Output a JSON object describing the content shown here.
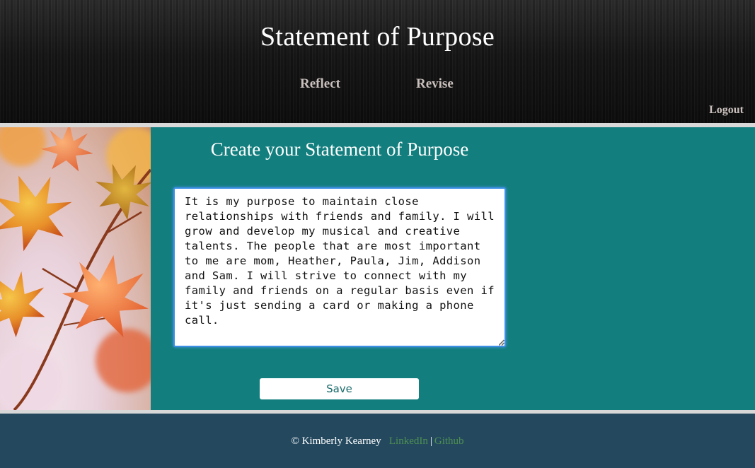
{
  "header": {
    "title": "Statement of Purpose",
    "nav": [
      {
        "label": "Reflect"
      },
      {
        "label": "Revise"
      }
    ],
    "logout_label": "Logout"
  },
  "main": {
    "heading": "Create your Statement of Purpose",
    "statement_text": "It is my purpose to maintain close relationships with friends and family. I will grow and develop my musical and creative talents. The people that are most important to me are mom, Heather, Paula, Jim, Addison and Sam. I will strive to connect with my family and friends on a regular basis even if it's just sending a card or making a phone call.",
    "save_label": "Save"
  },
  "footer": {
    "copyright": "© Kimberly Kearney",
    "links": [
      {
        "label": "LinkedIn"
      },
      {
        "label": "Github"
      }
    ],
    "separator": "|"
  },
  "colors": {
    "main_bg": "#127e7e",
    "footer_bg": "#24495f",
    "header_bg": "#161616",
    "footer_link": "#4e8f52",
    "nav_text": "#c9c0bd"
  }
}
